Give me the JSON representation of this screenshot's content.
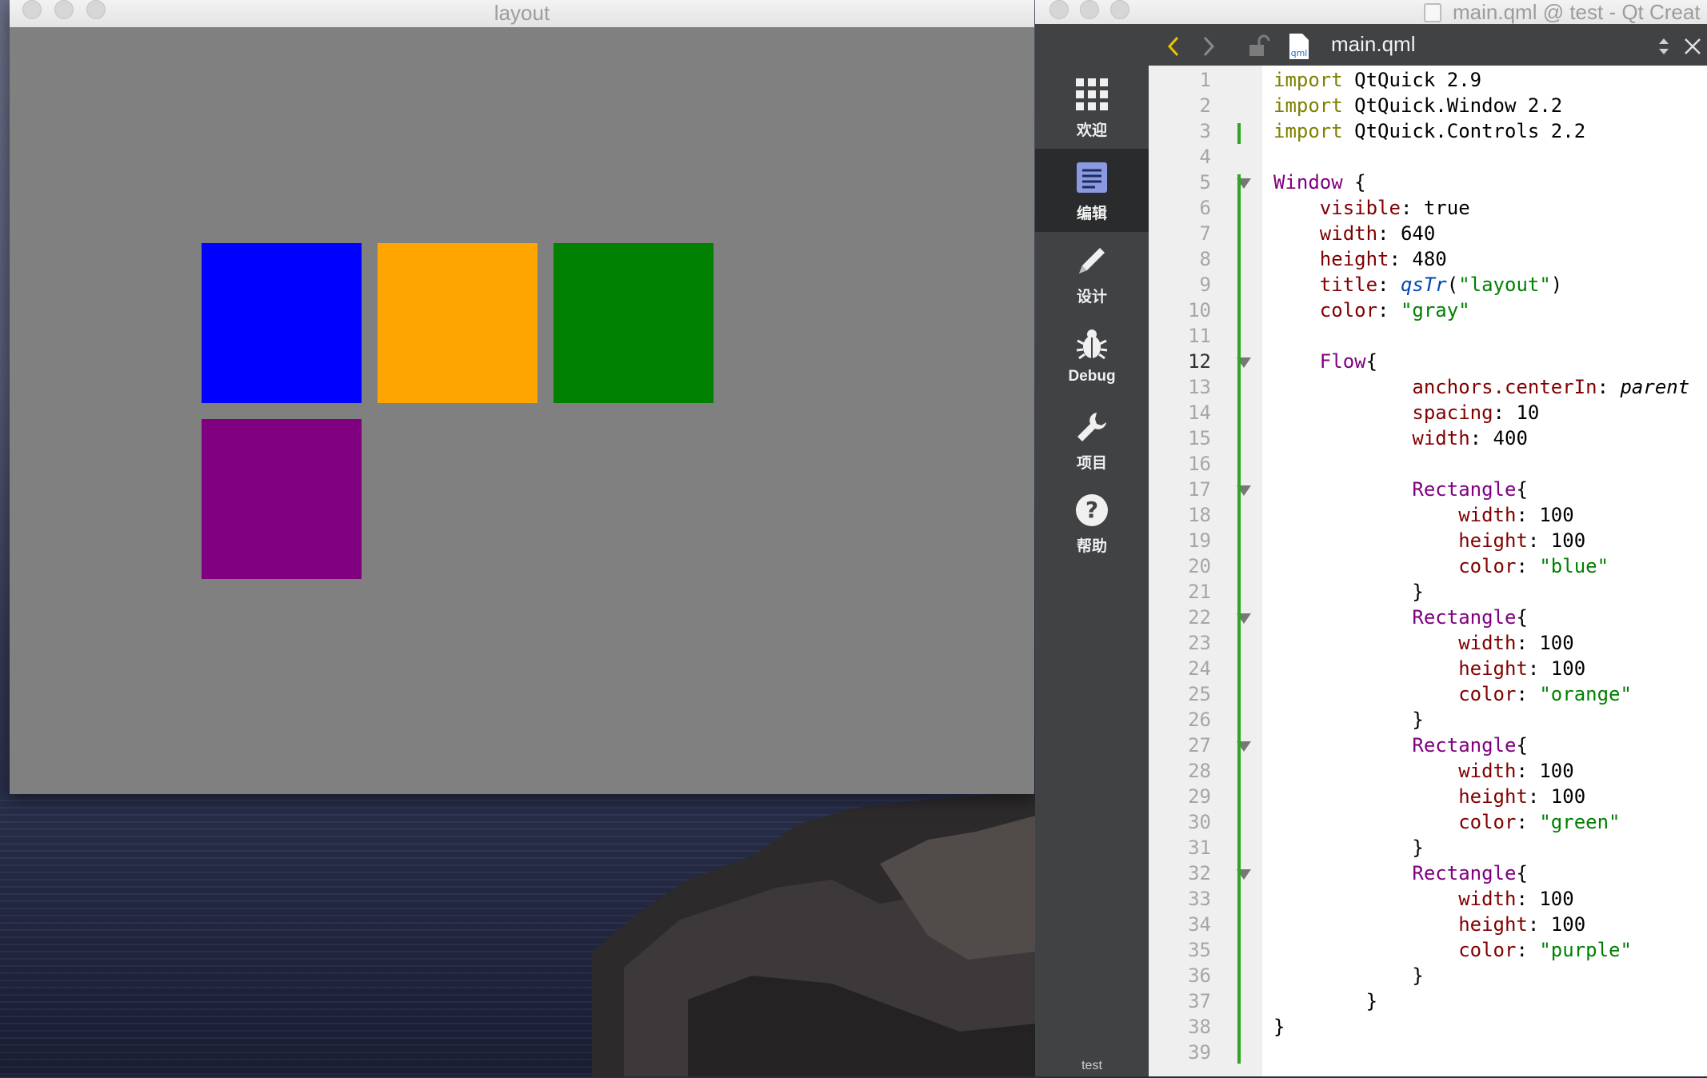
{
  "layout_window": {
    "title": "layout",
    "background": "#808080",
    "rectangles": [
      {
        "name": "blue",
        "color": "#0000ff"
      },
      {
        "name": "orange",
        "color": "#ffa500"
      },
      {
        "name": "green",
        "color": "#008000"
      },
      {
        "name": "purple",
        "color": "#800080"
      }
    ]
  },
  "qt_creator": {
    "window_title": "main.qml @ test - Qt Creat",
    "toolbar": {
      "back_icon": "chevron-left-icon",
      "forward_icon": "chevron-right-icon",
      "lock_icon": "lock-icon",
      "file_icon": "qml",
      "file_name": "main.qml",
      "updown_icon": "updown-arrows-icon",
      "close_icon": "close-icon"
    },
    "modes": [
      {
        "label": "欢迎",
        "icon": "grid-icon",
        "active": false
      },
      {
        "label": "编辑",
        "icon": "document-icon",
        "active": true
      },
      {
        "label": "设计",
        "icon": "pencil-icon",
        "active": false
      },
      {
        "label": "Debug",
        "icon": "bug-icon",
        "active": false
      },
      {
        "label": "项目",
        "icon": "wrench-icon",
        "active": false
      },
      {
        "label": "帮助",
        "icon": "help-icon",
        "active": false
      }
    ],
    "bottom_label": "test",
    "current_line": 12,
    "line_numbers": [
      "1",
      "2",
      "3",
      "4",
      "5",
      "6",
      "7",
      "8",
      "9",
      "10",
      "11",
      "12",
      "13",
      "14",
      "15",
      "16",
      "17",
      "18",
      "19",
      "20",
      "21",
      "22",
      "23",
      "24",
      "25",
      "26",
      "27",
      "28",
      "29",
      "30",
      "31",
      "32",
      "33",
      "34",
      "35",
      "36",
      "37",
      "38",
      "39"
    ],
    "fold_lines": [
      5,
      12,
      17,
      22,
      27,
      32
    ],
    "code_lines": [
      [
        {
          "t": "import",
          "c": "kw-import"
        },
        {
          "t": " QtQuick 2.9"
        }
      ],
      [
        {
          "t": "import",
          "c": "kw-import"
        },
        {
          "t": " QtQuick.Window 2.2"
        }
      ],
      [
        {
          "t": "import",
          "c": "kw-import"
        },
        {
          "t": " QtQuick.Controls 2.2"
        }
      ],
      [],
      [
        {
          "t": "Window",
          "c": "kw-type"
        },
        {
          "t": " {"
        }
      ],
      [
        {
          "t": "    "
        },
        {
          "t": "visible",
          "c": "prop"
        },
        {
          "t": ": true"
        }
      ],
      [
        {
          "t": "    "
        },
        {
          "t": "width",
          "c": "prop"
        },
        {
          "t": ": 640"
        }
      ],
      [
        {
          "t": "    "
        },
        {
          "t": "height",
          "c": "prop"
        },
        {
          "t": ": 480"
        }
      ],
      [
        {
          "t": "    "
        },
        {
          "t": "title",
          "c": "prop"
        },
        {
          "t": ": "
        },
        {
          "t": "qsTr",
          "c": "fn"
        },
        {
          "t": "("
        },
        {
          "t": "\"layout\"",
          "c": "str"
        },
        {
          "t": ")"
        }
      ],
      [
        {
          "t": "    "
        },
        {
          "t": "color",
          "c": "prop"
        },
        {
          "t": ": "
        },
        {
          "t": "\"gray\"",
          "c": "str"
        }
      ],
      [],
      [
        {
          "t": "    "
        },
        {
          "t": "Flow",
          "c": "kw-type"
        },
        {
          "t": "{"
        }
      ],
      [
        {
          "t": "            "
        },
        {
          "t": "anchors.centerIn",
          "c": "prop"
        },
        {
          "t": ": "
        },
        {
          "t": "parent",
          "c": "ident-it"
        }
      ],
      [
        {
          "t": "            "
        },
        {
          "t": "spacing",
          "c": "prop"
        },
        {
          "t": ": 10"
        }
      ],
      [
        {
          "t": "            "
        },
        {
          "t": "width",
          "c": "prop"
        },
        {
          "t": ": 400"
        }
      ],
      [],
      [
        {
          "t": "            "
        },
        {
          "t": "Rectangle",
          "c": "kw-type"
        },
        {
          "t": "{"
        }
      ],
      [
        {
          "t": "                "
        },
        {
          "t": "width",
          "c": "prop"
        },
        {
          "t": ": 100"
        }
      ],
      [
        {
          "t": "                "
        },
        {
          "t": "height",
          "c": "prop"
        },
        {
          "t": ": 100"
        }
      ],
      [
        {
          "t": "                "
        },
        {
          "t": "color",
          "c": "prop"
        },
        {
          "t": ": "
        },
        {
          "t": "\"blue\"",
          "c": "str"
        }
      ],
      [
        {
          "t": "            }"
        }
      ],
      [
        {
          "t": "            "
        },
        {
          "t": "Rectangle",
          "c": "kw-type"
        },
        {
          "t": "{"
        }
      ],
      [
        {
          "t": "                "
        },
        {
          "t": "width",
          "c": "prop"
        },
        {
          "t": ": 100"
        }
      ],
      [
        {
          "t": "                "
        },
        {
          "t": "height",
          "c": "prop"
        },
        {
          "t": ": 100"
        }
      ],
      [
        {
          "t": "                "
        },
        {
          "t": "color",
          "c": "prop"
        },
        {
          "t": ": "
        },
        {
          "t": "\"orange\"",
          "c": "str"
        }
      ],
      [
        {
          "t": "            }"
        }
      ],
      [
        {
          "t": "            "
        },
        {
          "t": "Rectangle",
          "c": "kw-type"
        },
        {
          "t": "{"
        }
      ],
      [
        {
          "t": "                "
        },
        {
          "t": "width",
          "c": "prop"
        },
        {
          "t": ": 100"
        }
      ],
      [
        {
          "t": "                "
        },
        {
          "t": "height",
          "c": "prop"
        },
        {
          "t": ": 100"
        }
      ],
      [
        {
          "t": "                "
        },
        {
          "t": "color",
          "c": "prop"
        },
        {
          "t": ": "
        },
        {
          "t": "\"green\"",
          "c": "str"
        }
      ],
      [
        {
          "t": "            }"
        }
      ],
      [
        {
          "t": "            "
        },
        {
          "t": "Rectangle",
          "c": "kw-type"
        },
        {
          "t": "{"
        }
      ],
      [
        {
          "t": "                "
        },
        {
          "t": "width",
          "c": "prop"
        },
        {
          "t": ": 100"
        }
      ],
      [
        {
          "t": "                "
        },
        {
          "t": "height",
          "c": "prop"
        },
        {
          "t": ": 100"
        }
      ],
      [
        {
          "t": "                "
        },
        {
          "t": "color",
          "c": "prop"
        },
        {
          "t": ": "
        },
        {
          "t": "\"purple\"",
          "c": "str"
        }
      ],
      [
        {
          "t": "            }"
        }
      ],
      [
        {
          "t": "        }"
        }
      ],
      [
        {
          "t": "}"
        }
      ],
      []
    ]
  }
}
